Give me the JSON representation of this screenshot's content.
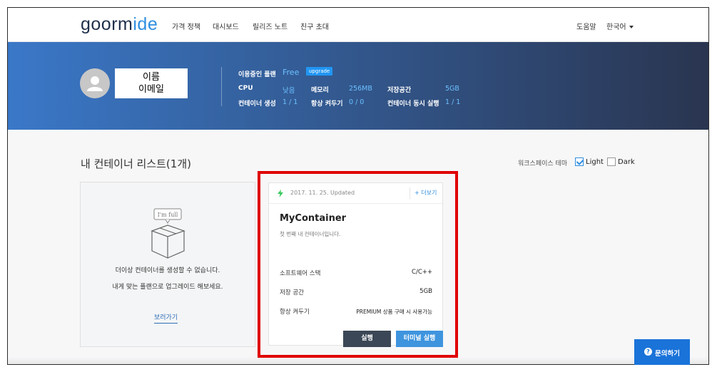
{
  "nav": {
    "logo_main": "goorm",
    "logo_accent": "ide",
    "links": [
      "가격 정책",
      "대시보드",
      "릴리즈 노트",
      "친구 초대"
    ],
    "help": "도움말",
    "language": "한국어"
  },
  "profile": {
    "name": "이름",
    "email": "이메일"
  },
  "plan": {
    "label": "이용중인 플랜",
    "name": "Free",
    "upgrade": "upgrade",
    "cpu_label": "CPU",
    "cpu_value": "낮음",
    "memory_label": "메모리",
    "memory_value": "256MB",
    "storage_label": "저장공간",
    "storage_value": "5GB",
    "create_label": "컨테이너 생성",
    "create_value": "1 / 1",
    "always_on_label": "항상 켜두기",
    "always_on_value": "0 / 0",
    "concurrent_label": "컨테이너 동시 실행",
    "concurrent_value": "1 / 1"
  },
  "main": {
    "title": "내 컨테이너 리스트(1개)",
    "theme_label": "워크스페이스 테마",
    "theme_light": "Light",
    "theme_dark": "Dark",
    "theme_selected": "Light"
  },
  "empty_card": {
    "badge": "I'm full",
    "line1": "더이상 컨테이너를 생성할 수 없습니다.",
    "line2": "내게 맞는 플랜으로 업그레이드 해보세요.",
    "link": "보러가기"
  },
  "container": {
    "updated": "2017. 11. 25. Updated",
    "more": "+ 더보기",
    "name": "MyContainer",
    "description": "첫 번째 내 컨테이너입니다.",
    "stack_label": "소프트웨어 스택",
    "stack_value": "C/C++",
    "storage_label": "저장 공간",
    "storage_value": "5GB",
    "always_on_label": "항상 켜두기",
    "always_on_value": "PREMIUM 상품 구매 시 사용가능",
    "run_button": "실행",
    "terminal_button": "터미널 실행"
  },
  "help_button": "문의하기",
  "colors": {
    "accent": "#2f8ee0",
    "highlight_border": "#e00000",
    "run_button": "#3b4756",
    "terminal_button": "#3f94de",
    "help_button": "#1a73d9"
  }
}
